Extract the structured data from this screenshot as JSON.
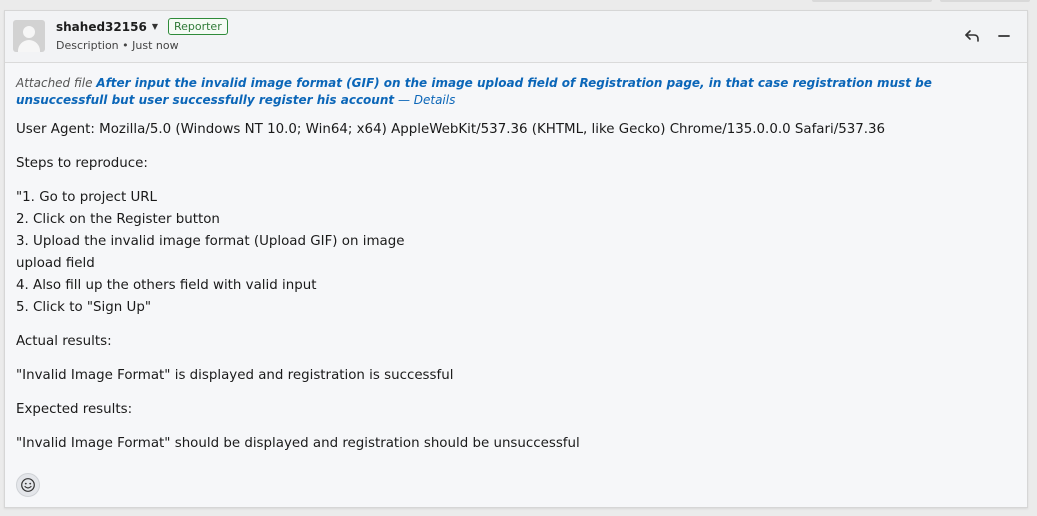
{
  "comment": {
    "author": "shahed32156",
    "role_badge": "Reporter",
    "meta": "Description • Just now",
    "attached": {
      "prefix": "Attached file ",
      "link": "After input the invalid image format (GIF) on the image upload field of Registration page, in that case registration must be unsuccessfull but user successfully register his account",
      "details": " — Details"
    },
    "user_agent": "User Agent: Mozilla/5.0 (Windows NT 10.0; Win64; x64) AppleWebKit/537.36 (KHTML, like Gecko) Chrome/135.0.0.0 Safari/537.36",
    "steps_heading": "Steps to reproduce:",
    "steps": [
      "\"1. Go to project URL",
      "2. Click on the Register button",
      "3. Upload the invalid image format (Upload GIF) on image",
      "upload field",
      "4. Also fill up the others field with valid input",
      "5. Click to \"Sign Up\""
    ],
    "actual_heading": "Actual results:",
    "actual_text": "\"Invalid Image Format\" is displayed and registration is successful",
    "expected_heading": "Expected results:",
    "expected_text": "\"Invalid Image Format\" should be displayed and registration should be unsuccessful"
  },
  "icons": {
    "reply": "reply-icon",
    "collapse": "collapse-icon",
    "emoji": "emoji-icon",
    "avatar": "avatar-placeholder"
  }
}
